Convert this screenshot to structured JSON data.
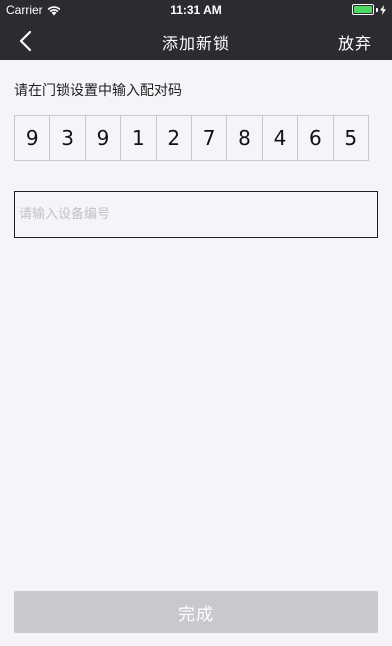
{
  "status_bar": {
    "carrier": "Carrier",
    "time": "11:31 AM",
    "battery_color": "#4cd964"
  },
  "nav": {
    "back_icon": "chevron-left-icon",
    "title": "添加新锁",
    "action_label": "放弃"
  },
  "instruction": "请在门锁设置中输入配对码",
  "pair_code": [
    "9",
    "3",
    "9",
    "1",
    "2",
    "7",
    "8",
    "4",
    "6",
    "5"
  ],
  "device_input": {
    "value": "",
    "placeholder": "请输入设备编号"
  },
  "done_button": {
    "label": "完成"
  },
  "colors": {
    "nav_background": "#2b2b30",
    "page_background": "#f5f4f9",
    "button_disabled": "#c8c8cd"
  }
}
